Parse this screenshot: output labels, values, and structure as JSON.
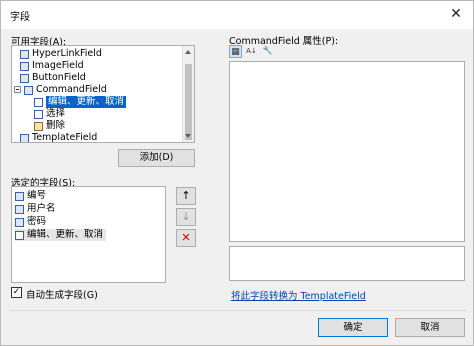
{
  "window": {
    "title": "字段",
    "close_glyph": "✕"
  },
  "available": {
    "label": "可用字段(A):",
    "items": [
      {
        "label": "HyperLinkField",
        "icon": "field-icon"
      },
      {
        "label": "ImageField",
        "icon": "field-icon"
      },
      {
        "label": "ButtonField",
        "icon": "field-icon"
      },
      {
        "label": "CommandField",
        "icon": "field-icon",
        "expanded": true
      },
      {
        "label": "编辑、更新、取消",
        "icon": "command-icon",
        "selected": true
      },
      {
        "label": "选择",
        "icon": "command-icon"
      },
      {
        "label": "删除",
        "icon": "delete-icon"
      },
      {
        "label": "TemplateField",
        "icon": "field-icon"
      }
    ],
    "add_button": "添加(D)"
  },
  "selected": {
    "label": "选定的字段(S):",
    "items": [
      {
        "label": "编号"
      },
      {
        "label": "用户名"
      },
      {
        "label": "密码"
      },
      {
        "label": "编辑、更新、取消"
      }
    ],
    "move_up_glyph": "↑",
    "move_down_glyph": "↓",
    "delete_glyph": "✕"
  },
  "autogenerate": {
    "label": "自动生成字段(G)",
    "checked": true,
    "check_glyph": "✓"
  },
  "properties": {
    "label": "CommandField 属性(P):",
    "toolbar": [
      "categorized-icon",
      "alphabetical-icon",
      "property-pages-icon"
    ],
    "az_glyph": "A↓",
    "wrench_glyph": "🔧",
    "cat_glyph": "▦"
  },
  "convert_link": "将此字段转换为 TemplateField",
  "buttons": {
    "ok": "确定",
    "cancel": "取消"
  },
  "colors": {
    "selection": "#0a64c8",
    "link": "#0645ad",
    "delete": "#cc0000"
  }
}
